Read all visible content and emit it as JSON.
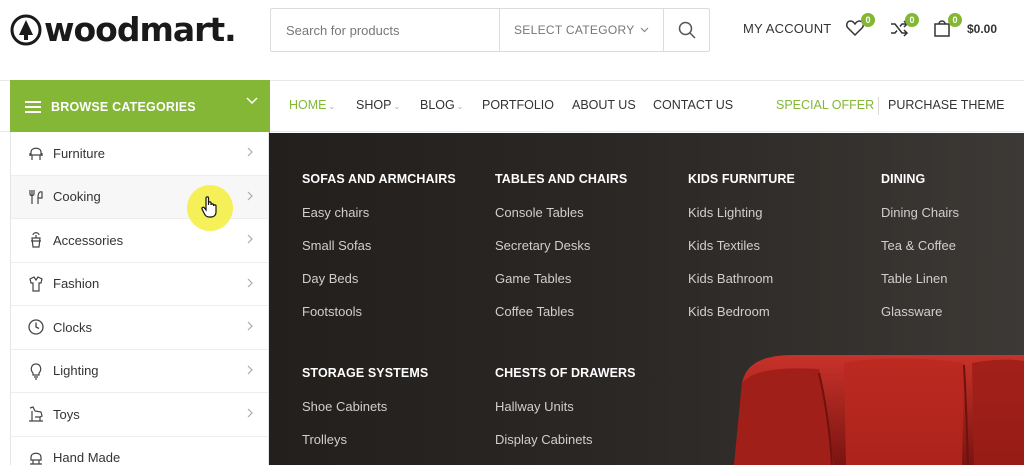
{
  "brand": {
    "name": "woodmart."
  },
  "search": {
    "placeholder": "Search for products",
    "category": "SELECT CATEGORY"
  },
  "header": {
    "account": "MY ACCOUNT",
    "wishlist_count": "0",
    "compare_count": "0",
    "cart_count": "0",
    "cart_total": "$0.00"
  },
  "browse": {
    "label": "BROWSE CATEGORIES"
  },
  "nav": {
    "items": [
      {
        "label": "HOME"
      },
      {
        "label": "SHOP"
      },
      {
        "label": "BLOG"
      },
      {
        "label": "PORTFOLIO"
      },
      {
        "label": "ABOUT US"
      },
      {
        "label": "CONTACT US"
      }
    ],
    "special": "SPECIAL OFFER",
    "purchase": "PURCHASE THEME"
  },
  "categories": [
    {
      "label": "Furniture",
      "icon": "chair-icon"
    },
    {
      "label": "Cooking",
      "icon": "cooking-icon"
    },
    {
      "label": "Accessories",
      "icon": "accessories-icon"
    },
    {
      "label": "Fashion",
      "icon": "fashion-icon"
    },
    {
      "label": "Clocks",
      "icon": "clock-icon"
    },
    {
      "label": "Lighting",
      "icon": "lightbulb-icon"
    },
    {
      "label": "Toys",
      "icon": "toy-icon"
    },
    {
      "label": "Hand Made",
      "icon": "handmade-icon"
    }
  ],
  "mega": {
    "columns": [
      {
        "title": "SOFAS AND ARMCHAIRS",
        "links": [
          "Easy chairs",
          "Small Sofas",
          "Day Beds",
          "Footstools"
        ]
      },
      {
        "title": "TABLES AND CHAIRS",
        "links": [
          "Console Tables",
          "Secretary Desks",
          "Game Tables",
          "Coffee Tables"
        ]
      },
      {
        "title": "KIDS FURNITURE",
        "links": [
          "Kids Lighting",
          "Kids Textiles",
          "Kids Bathroom",
          "Kids Bedroom"
        ]
      },
      {
        "title": "DINING",
        "links": [
          "Dining Chairs",
          "Tea & Coffee",
          "Table Linen",
          "Glassware"
        ]
      },
      {
        "title": "STORAGE SYSTEMS",
        "links": [
          "Shoe Cabinets",
          "Trolleys"
        ]
      },
      {
        "title": "CHESTS OF DRAWERS",
        "links": [
          "Hallway Units",
          "Display Cabinets"
        ]
      }
    ]
  },
  "colors": {
    "accent": "#83b735",
    "mega_bg": "#2b2725",
    "sofa": "#b3221c"
  }
}
